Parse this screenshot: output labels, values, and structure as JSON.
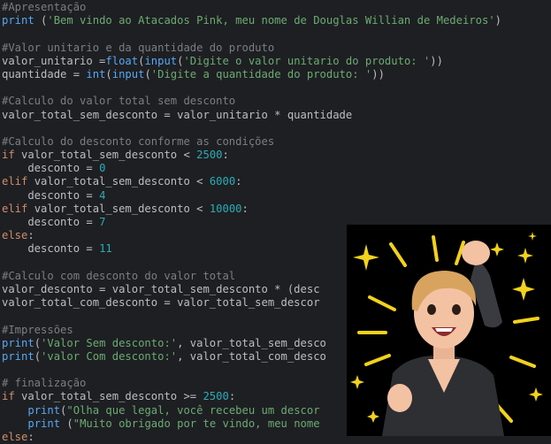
{
  "code_lines": [
    [
      {
        "t": "#Apresentação",
        "c": "cm"
      }
    ],
    [
      {
        "t": "print ",
        "c": "fn"
      },
      {
        "t": "(",
        "c": ""
      },
      {
        "t": "'Bem vindo ao Atacados Pink, meu nome de Douglas Willian de Medeiros'",
        "c": "st"
      },
      {
        "t": ")",
        "c": ""
      }
    ],
    [],
    [
      {
        "t": "#Valor unitario e da quantidade do produto",
        "c": "cm"
      }
    ],
    [
      {
        "t": "valor_unitario =",
        "c": ""
      },
      {
        "t": "float",
        "c": "fn"
      },
      {
        "t": "(",
        "c": ""
      },
      {
        "t": "input",
        "c": "fn"
      },
      {
        "t": "(",
        "c": ""
      },
      {
        "t": "'Digite o valor unitario do produto: '",
        "c": "st"
      },
      {
        "t": "))",
        "c": ""
      }
    ],
    [
      {
        "t": "quantidade = ",
        "c": ""
      },
      {
        "t": "int",
        "c": "fn"
      },
      {
        "t": "(",
        "c": ""
      },
      {
        "t": "input",
        "c": "fn"
      },
      {
        "t": "(",
        "c": ""
      },
      {
        "t": "'Digite a quantidade do produto: '",
        "c": "st"
      },
      {
        "t": "))",
        "c": ""
      }
    ],
    [],
    [
      {
        "t": "#Calculo do valor total sem desconto",
        "c": "cm"
      }
    ],
    [
      {
        "t": "valor_total_sem_desconto = valor_unitario * quantidade",
        "c": ""
      }
    ],
    [],
    [
      {
        "t": "#Calculo do desconto conforme as condições",
        "c": "cm"
      }
    ],
    [
      {
        "t": "if ",
        "c": "kw"
      },
      {
        "t": "valor_total_sem_desconto < ",
        "c": ""
      },
      {
        "t": "2500",
        "c": "nm"
      },
      {
        "t": ":",
        "c": ""
      }
    ],
    [
      {
        "t": "    desconto = ",
        "c": ""
      },
      {
        "t": "0",
        "c": "nm"
      }
    ],
    [
      {
        "t": "elif ",
        "c": "kw"
      },
      {
        "t": "valor_total_sem_desconto < ",
        "c": ""
      },
      {
        "t": "6000",
        "c": "nm"
      },
      {
        "t": ":",
        "c": ""
      }
    ],
    [
      {
        "t": "    desconto = ",
        "c": ""
      },
      {
        "t": "4",
        "c": "nm"
      }
    ],
    [
      {
        "t": "elif ",
        "c": "kw"
      },
      {
        "t": "valor_total_sem_desconto < ",
        "c": ""
      },
      {
        "t": "10000",
        "c": "nm"
      },
      {
        "t": ":",
        "c": ""
      }
    ],
    [
      {
        "t": "    desconto = ",
        "c": ""
      },
      {
        "t": "7",
        "c": "nm"
      }
    ],
    [
      {
        "t": "else",
        "c": "kw"
      },
      {
        "t": ":",
        "c": ""
      }
    ],
    [
      {
        "t": "    desconto = ",
        "c": ""
      },
      {
        "t": "11",
        "c": "nm"
      }
    ],
    [],
    [
      {
        "t": "#Calculo com desconto do valor total",
        "c": "cm"
      }
    ],
    [
      {
        "t": "valor_desconto = valor_total_sem_desconto * (desc",
        "c": ""
      }
    ],
    [
      {
        "t": "valor_total_com_desconto = valor_total_sem_descor",
        "c": ""
      }
    ],
    [],
    [
      {
        "t": "#Impressões",
        "c": "cm"
      }
    ],
    [
      {
        "t": "print",
        "c": "fn"
      },
      {
        "t": "(",
        "c": ""
      },
      {
        "t": "'Valor Sem desconto:'",
        "c": "st"
      },
      {
        "t": ", valor_total_sem_desco",
        "c": ""
      }
    ],
    [
      {
        "t": "print",
        "c": "fn"
      },
      {
        "t": "(",
        "c": ""
      },
      {
        "t": "'valor Com desconto:'",
        "c": "st"
      },
      {
        "t": ", valor_total_com_desco",
        "c": ""
      }
    ],
    [],
    [
      {
        "t": "# finalização",
        "c": "cm"
      }
    ],
    [
      {
        "t": "if ",
        "c": "kw"
      },
      {
        "t": "valor_total_sem_desconto >= ",
        "c": ""
      },
      {
        "t": "2500",
        "c": "nm"
      },
      {
        "t": ":",
        "c": ""
      }
    ],
    [
      {
        "t": "    ",
        "c": ""
      },
      {
        "t": "print",
        "c": "fn"
      },
      {
        "t": "(",
        "c": ""
      },
      {
        "t": "\"Olha que legal, você recebeu um descor",
        "c": "st"
      }
    ],
    [
      {
        "t": "    ",
        "c": ""
      },
      {
        "t": "print ",
        "c": "fn"
      },
      {
        "t": "(",
        "c": ""
      },
      {
        "t": "\"Muito obrigado por te vindo, meu nome",
        "c": "st"
      }
    ],
    [
      {
        "t": "else",
        "c": "kw"
      },
      {
        "t": ":",
        "c": ""
      }
    ]
  ],
  "colors": {
    "background": "#1e1f22",
    "text": "#bcbec4",
    "comment": "#7a7e85",
    "function": "#56a8f5",
    "string": "#6aab73",
    "keyword": "#cf8e6d",
    "number": "#2aacb8"
  },
  "sticker": {
    "icon": "celebrating-avatar-sticker"
  }
}
